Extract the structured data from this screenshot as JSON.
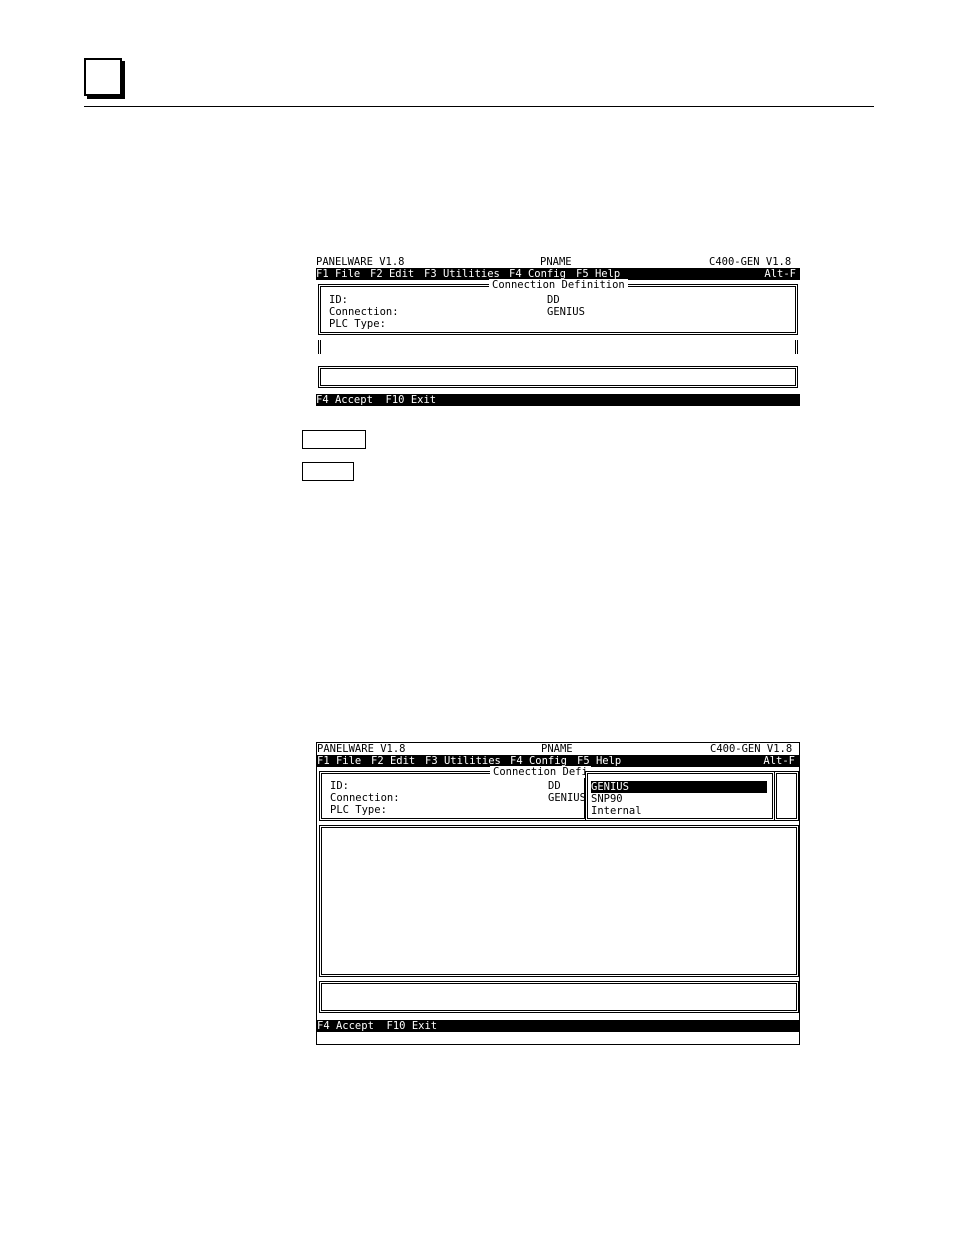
{
  "screen1": {
    "title_left": "PANELWARE V1.8",
    "title_center": "PNAME",
    "title_right": "C400-GEN V1.8",
    "menu": {
      "items": [
        "F1 File",
        "F2 Edit",
        "F3 Utilities",
        "F4 Config",
        "F5 Help"
      ],
      "shortcut": "Alt-F"
    },
    "dialog": {
      "title": "Connection Definition",
      "fields": [
        {
          "label": "ID:",
          "value": "DD"
        },
        {
          "label": "Connection:",
          "value": "GENIUS"
        },
        {
          "label": "PLC Type:",
          "value": ""
        }
      ]
    },
    "status_bar": "F4 Accept  F10 Exit"
  },
  "screen2": {
    "title_left": "PANELWARE V1.8",
    "title_center": "PNAME",
    "title_right": "C400-GEN V1.8",
    "menu": {
      "items": [
        "F1 File",
        "F2 Edit",
        "F3 Utilities",
        "F4 Config",
        "F5 Help"
      ],
      "shortcut": "Alt-F"
    },
    "dialog": {
      "title": "Connection Defi",
      "fields": [
        {
          "label": "ID:",
          "value": "DD"
        },
        {
          "label": "Connection:",
          "value": "GENIUS"
        },
        {
          "label": "PLC Type:",
          "value": ""
        }
      ]
    },
    "dropdown": {
      "options": [
        "GENIUS",
        "SNP90",
        "Internal"
      ],
      "selected_index": 0
    },
    "status_bar": "F4 Accept  F10 Exit"
  }
}
